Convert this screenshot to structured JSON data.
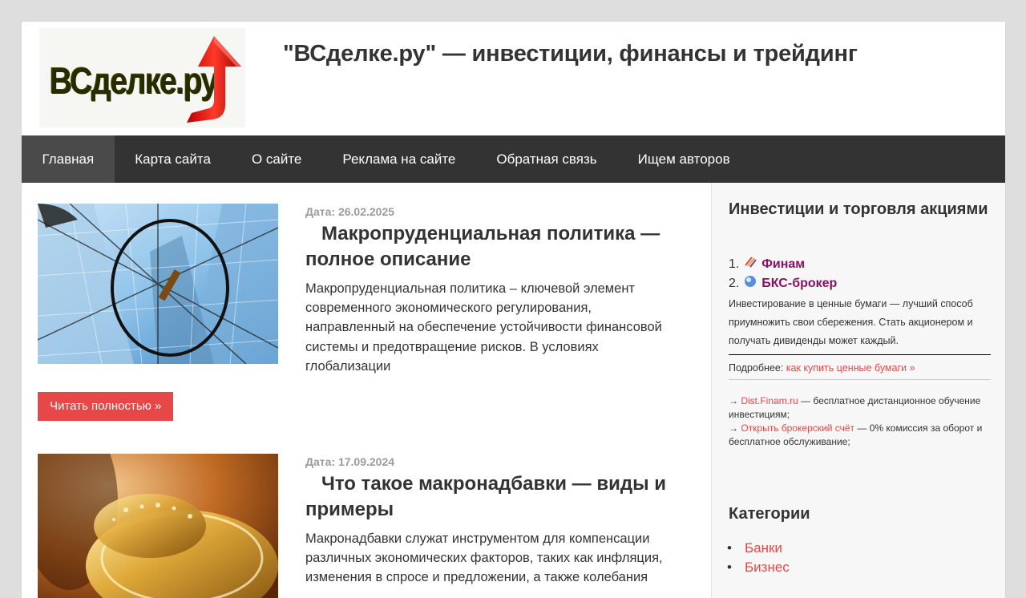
{
  "header": {
    "logo_text": "ВСделке.ру",
    "site_title": "\"ВСделке.ру\" — инвестиции, финансы и трейдинг"
  },
  "nav": {
    "items": [
      {
        "label": "Главная"
      },
      {
        "label": "Карта сайта"
      },
      {
        "label": "О сайте"
      },
      {
        "label": "Реклама на сайте"
      },
      {
        "label": "Обратная связь"
      },
      {
        "label": "Ищем авторов"
      }
    ]
  },
  "posts": [
    {
      "meta": "Дата: 26.02.2025",
      "title": "Макропруденциальная политика — полное описание",
      "excerpt": "Макропруденциальная политика – ключевой элемент современного экономического регулирования, направленный на обеспечение устойчивости финансовой системы и предотвращение рисков. В условиях глобализации",
      "read_more": "Читать полностью »"
    },
    {
      "meta": "Дата: 17.09.2024",
      "title": "Что такое макронадбавки — виды и примеры",
      "excerpt": "Макронадбавки служат инструментом для компенсации различных экономических факторов, таких как инфляция, изменения в спросе и предложении, а также колебания"
    }
  ],
  "sidebar": {
    "widget1_title": "Инвестиции и торговля акциями",
    "brokers": [
      {
        "num": "1.",
        "name": "Финам"
      },
      {
        "num": "2.",
        "name": "БКС-брокер"
      }
    ],
    "invest_text": "Инвестирование в ценные бумаги — лучший способ приумножить свои сбережения. Стать акционером и получать дивиденды может каждый.",
    "more_prefix": "Подробнее:",
    "more_link": "как купить ценные бумаги »",
    "promo": [
      {
        "arrow": "→",
        "link": "Dist.Finam.ru",
        "text": " — бесплатное дистанционное обучение инвестициям;"
      },
      {
        "arrow": "→",
        "link": "Открыть брокерский счёт",
        "text": " — 0% комиссия за оборот и бесплатное обслуживание;"
      }
    ],
    "widget2_title": "Категории",
    "categories": [
      {
        "label": "Банки"
      },
      {
        "label": "Бизнес"
      }
    ]
  }
}
